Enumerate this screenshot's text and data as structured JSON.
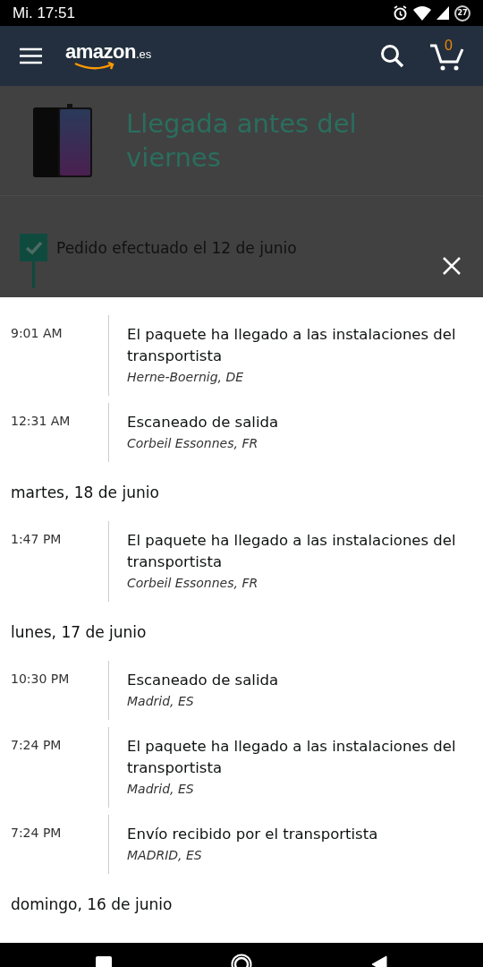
{
  "status_bar": {
    "time": "Mi. 17:51",
    "battery": "27"
  },
  "header": {
    "logo": "amazon",
    "logo_suffix": ".es",
    "cart_count": "0"
  },
  "shipment": {
    "title": "Llegada antes del viernes",
    "steps": [
      {
        "label": "Pedido efectuado el 12 de junio",
        "checked": true
      }
    ]
  },
  "tracking": {
    "groups": [
      {
        "events": [
          {
            "time": "9:01 AM",
            "description": "El paquete ha llegado a las instalaciones del transportista",
            "location": "Herne-Boernig, DE"
          },
          {
            "time": "12:31 AM",
            "description": "Escaneado de salida",
            "location": "Corbeil Essonnes, FR"
          }
        ]
      },
      {
        "date": "martes, 18 de junio",
        "events": [
          {
            "time": "1:47 PM",
            "description": "El paquete ha llegado a las instalaciones del transportista",
            "location": "Corbeil Essonnes, FR"
          }
        ]
      },
      {
        "date": "lunes, 17 de junio",
        "events": [
          {
            "time": "10:30 PM",
            "description": "Escaneado de salida",
            "location": "Madrid, ES"
          },
          {
            "time": "7:24 PM",
            "description": "El paquete ha llegado a las instalaciones del transportista",
            "location": "Madrid, ES"
          },
          {
            "time": "7:24 PM",
            "description": "Envío recibido por el transportista",
            "location": "MADRID, ES"
          }
        ]
      },
      {
        "date": "domingo, 16 de junio"
      }
    ]
  }
}
